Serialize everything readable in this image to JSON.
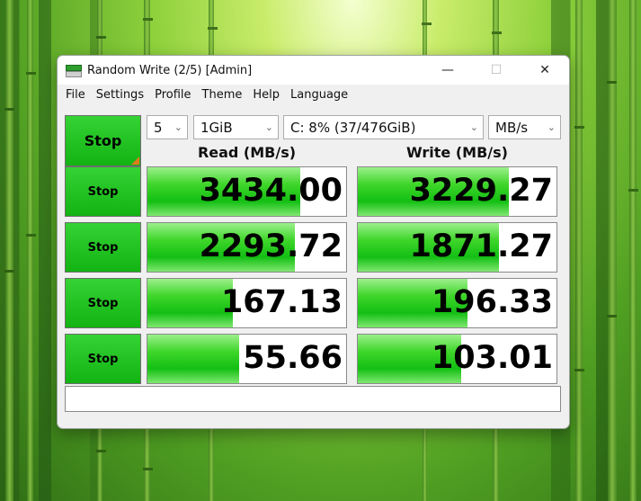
{
  "window": {
    "title": "Random Write (2/5) [Admin]",
    "minimize": "—",
    "maximize": "☐",
    "close": "✕"
  },
  "menu": [
    "File",
    "Settings",
    "Profile",
    "Theme",
    "Help",
    "Language"
  ],
  "controls": {
    "main_stop_label": "Stop",
    "count": "5",
    "size": "1GiB",
    "drive": "C: 8% (37/476GiB)",
    "unit": "MB/s"
  },
  "headers": {
    "read": "Read (MB/s)",
    "write": "Write (MB/s)"
  },
  "rows": [
    {
      "button": "Stop",
      "read": "3434.00",
      "write": "3229.27",
      "read_fill": 0.77,
      "write_fill": 0.76
    },
    {
      "button": "Stop",
      "read": "2293.72",
      "write": "1871.27",
      "read_fill": 0.74,
      "write_fill": 0.71
    },
    {
      "button": "Stop",
      "read": "167.13",
      "write": "196.33",
      "read_fill": 0.43,
      "write_fill": 0.55
    },
    {
      "button": "Stop",
      "read": "55.66",
      "write": "103.01",
      "read_fill": 0.46,
      "write_fill": 0.52
    }
  ],
  "status_text": "",
  "colors": {
    "accent_green": "#13bf13",
    "corner_orange": "#e07a1c"
  }
}
